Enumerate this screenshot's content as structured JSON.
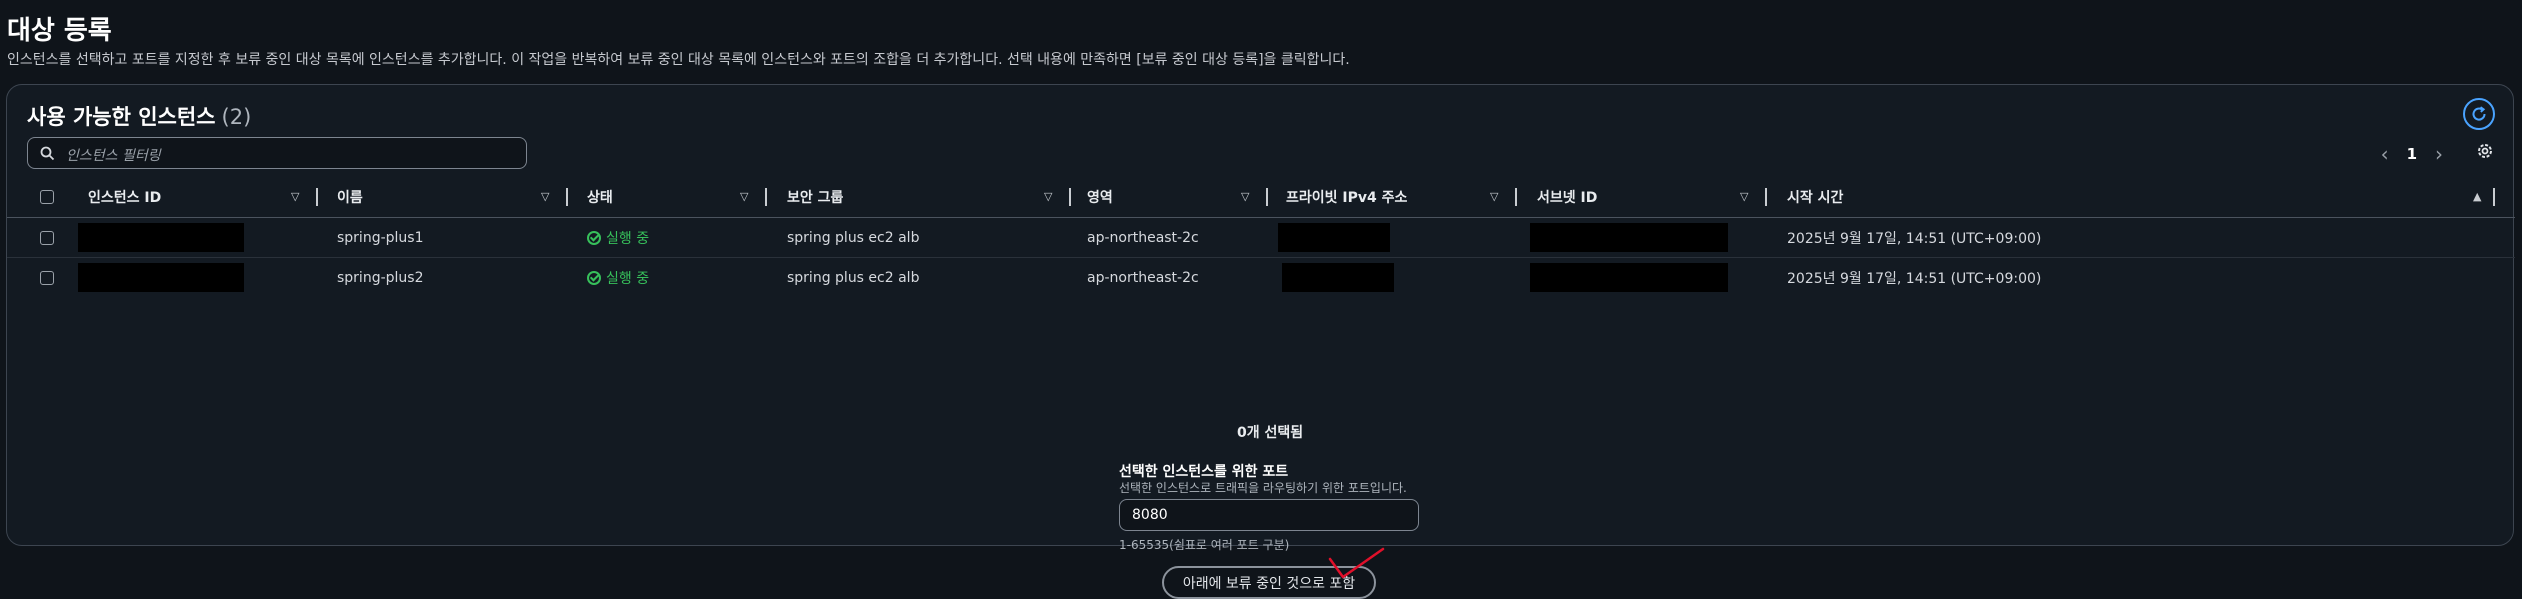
{
  "page": {
    "title": "대상 등록",
    "description": "인스턴스를 선택하고 포트를 지정한 후 보류 중인 대상 목록에 인스턴스를 추가합니다. 이 작업을 반복하여 보류 중인 대상 목록에 인스턴스와 포트의 조합을 더 추가합니다. 선택 내용에 만족하면 [보류 중인 대상 등록]을 클릭합니다."
  },
  "panel": {
    "title": "사용 가능한 인스턴스",
    "count": "(2)",
    "search_placeholder": "인스턴스 필터링",
    "page_number": "1",
    "icons": [
      "refresh-icon",
      "search-icon",
      "chevron-left-icon",
      "chevron-right-icon",
      "gear-icon"
    ]
  },
  "table": {
    "columns": [
      "인스턴스 ID",
      "이름",
      "상태",
      "보안 그룹",
      "영역",
      "프라이빗 IPv4 주소",
      "서브넷 ID",
      "시작 시간"
    ],
    "rows": [
      {
        "instance_id": "",
        "name": "spring-plus1",
        "status": "실행 중",
        "security_group": "spring plus ec2 alb",
        "zone": "ap-northeast-2c",
        "private_ip": "",
        "subnet_id": "",
        "launch_time": "2025년 9월 17일, 14:51 (UTC+09:00)"
      },
      {
        "instance_id": "",
        "name": "spring-plus2",
        "status": "실행 중",
        "security_group": "spring plus ec2 alb",
        "zone": "ap-northeast-2c",
        "private_ip": "",
        "subnet_id": "",
        "launch_time": "2025년 9월 17일, 14:51 (UTC+09:00)"
      }
    ]
  },
  "selection": {
    "selected_count": "0개 선택됨",
    "port_label": "선택한 인스턴스를 위한 포트",
    "port_description": "선택한 인스턴스로 트래픽을 라우팅하기 위한 포트입니다.",
    "port_value": "8080",
    "port_hint": "1-65535(쉼표로 여러 포트 구분)",
    "include_button": "아래에 보류 중인 것으로 포함"
  },
  "colors": {
    "accent": "#4aa3ff",
    "running": "#37c05b",
    "annotation": "#e0102a"
  }
}
